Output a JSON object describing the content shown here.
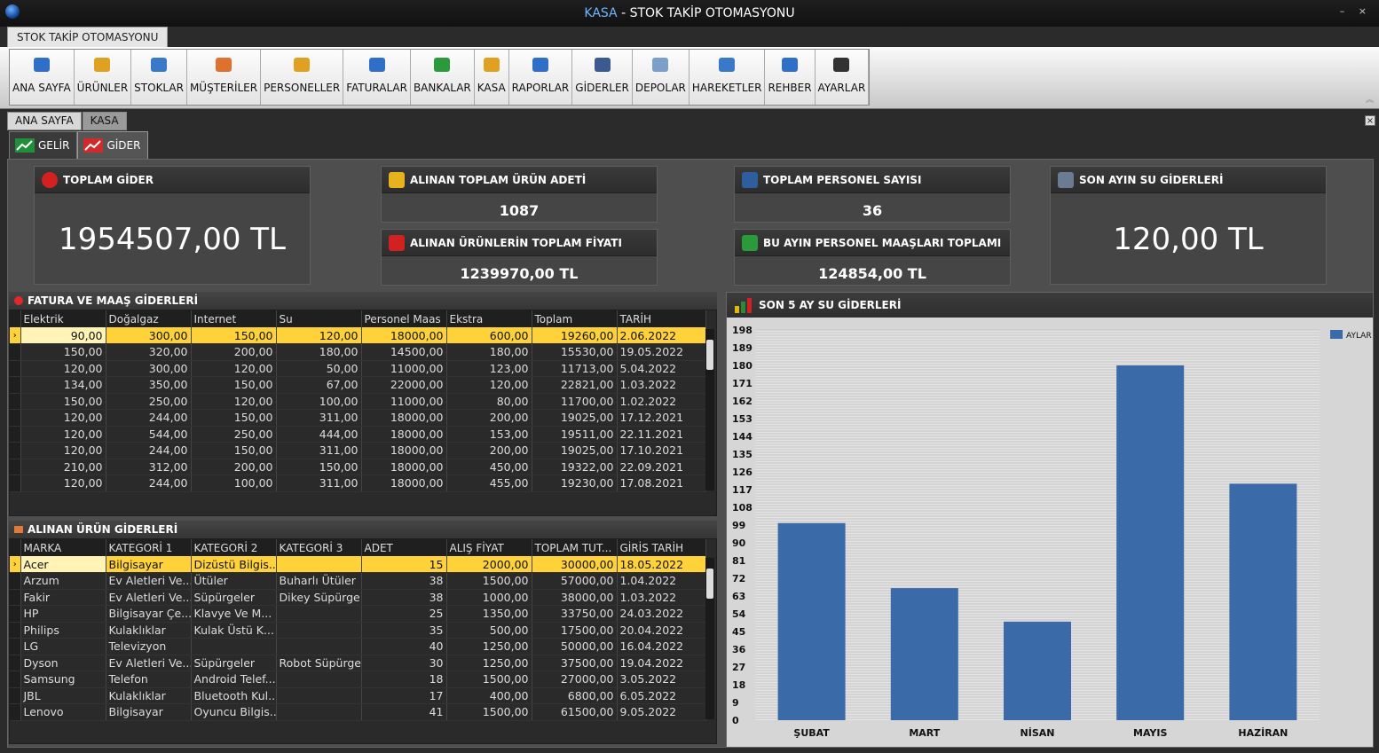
{
  "window": {
    "title_prefix": "KASA",
    "title_rest": " - STOK TAKİP OTOMASYONU",
    "controls": "– ×"
  },
  "app_tab": "STOK TAKİP OTOMASYONU",
  "ribbon": [
    {
      "label": "ANA SAYFA",
      "icon": "home-icon"
    },
    {
      "label": "ÜRÜNLER",
      "icon": "products-icon"
    },
    {
      "label": "STOKLAR",
      "icon": "stock-chart-icon"
    },
    {
      "label": "MÜŞTERİLER",
      "icon": "handshake-icon"
    },
    {
      "label": "PERSONELLER",
      "icon": "staff-icon"
    },
    {
      "label": "FATURALAR",
      "icon": "invoice-icon"
    },
    {
      "label": "BANKALAR",
      "icon": "bank-icon"
    },
    {
      "label": "KASA",
      "icon": "cash-icon"
    },
    {
      "label": "RAPORLAR",
      "icon": "clipboard-icon"
    },
    {
      "label": "GİDERLER",
      "icon": "expense-icon"
    },
    {
      "label": "DEPOLAR",
      "icon": "warehouse-icon"
    },
    {
      "label": "HAREKETLER",
      "icon": "activity-icon"
    },
    {
      "label": "REHBER",
      "icon": "phone-icon"
    },
    {
      "label": "AYARLAR",
      "icon": "gears-icon"
    }
  ],
  "doc_tabs": [
    "ANA SAYFA",
    "KASA"
  ],
  "sub_tabs": [
    "GELİR",
    "GİDER"
  ],
  "cards": {
    "total_expense": {
      "title": "TOPLAM GİDER",
      "value": "1954507,00 TL"
    },
    "product_count": {
      "title": "ALINAN TOPLAM ÜRÜN ADETİ",
      "value": "1087"
    },
    "product_price": {
      "title": "ALINAN ÜRÜNLERİN TOPLAM FİYATI",
      "value": "1239970,00 TL"
    },
    "staff_count": {
      "title": "TOPLAM PERSONEL SAYISI",
      "value": "36"
    },
    "staff_salary": {
      "title": "BU AYIN PERSONEL MAAŞLARI TOPLAMI",
      "value": "124854,00 TL"
    },
    "water": {
      "title": "SON AYIN SU GİDERLERİ",
      "value": "120,00 TL"
    }
  },
  "bills": {
    "title": "FATURA VE MAAŞ GİDERLERİ",
    "columns": [
      "Elektrik",
      "Doğalgaz",
      "Internet",
      "Su",
      "Personel Maas",
      "Ekstra",
      "Toplam",
      "TARİH"
    ],
    "rows": [
      [
        "90,00",
        "300,00",
        "150,00",
        "120,00",
        "18000,00",
        "600,00",
        "19260,00",
        "2.06.2022"
      ],
      [
        "150,00",
        "320,00",
        "200,00",
        "180,00",
        "14500,00",
        "180,00",
        "15530,00",
        "19.05.2022"
      ],
      [
        "120,00",
        "300,00",
        "120,00",
        "50,00",
        "11000,00",
        "123,00",
        "11713,00",
        "5.04.2022"
      ],
      [
        "134,00",
        "350,00",
        "150,00",
        "67,00",
        "22000,00",
        "120,00",
        "22821,00",
        "1.03.2022"
      ],
      [
        "150,00",
        "250,00",
        "120,00",
        "100,00",
        "11000,00",
        "80,00",
        "11700,00",
        "1.02.2022"
      ],
      [
        "120,00",
        "244,00",
        "150,00",
        "311,00",
        "18000,00",
        "200,00",
        "19025,00",
        "17.12.2021"
      ],
      [
        "120,00",
        "544,00",
        "250,00",
        "444,00",
        "18000,00",
        "153,00",
        "19511,00",
        "22.11.2021"
      ],
      [
        "120,00",
        "244,00",
        "150,00",
        "311,00",
        "18000,00",
        "200,00",
        "19025,00",
        "17.10.2021"
      ],
      [
        "210,00",
        "312,00",
        "200,00",
        "150,00",
        "18000,00",
        "450,00",
        "19322,00",
        "22.09.2021"
      ],
      [
        "120,00",
        "244,00",
        "100,00",
        "311,00",
        "18000,00",
        "455,00",
        "19230,00",
        "17.08.2021"
      ]
    ]
  },
  "products": {
    "title": "ALINAN ÜRÜN GİDERLERİ",
    "columns": [
      "MARKA",
      "KATEGORİ 1",
      "KATEGORİ 2",
      "KATEGORİ 3",
      "ADET",
      "ALIŞ FİYAT",
      "TOPLAM TUT...",
      "GİRİS TARİH"
    ],
    "rows": [
      [
        "Acer",
        "Bilgisayar",
        "Dizüstü Bilgis...",
        "",
        "15",
        "2000,00",
        "30000,00",
        "18.05.2022"
      ],
      [
        "Arzum",
        "Ev Aletleri Ve...",
        "Ütüler",
        "Buharlı Ütüler",
        "38",
        "1500,00",
        "57000,00",
        "1.04.2022"
      ],
      [
        "Fakir",
        "Ev Aletleri Ve...",
        "Süpürgeler",
        "Dikey Süpürge",
        "38",
        "1000,00",
        "38000,00",
        "1.03.2022"
      ],
      [
        "HP",
        "Bilgisayar Çe...",
        "Klavye Ve M...",
        "",
        "25",
        "1350,00",
        "33750,00",
        "24.03.2022"
      ],
      [
        "Philips",
        "Kulaklıklar",
        "Kulak Üstü K...",
        "",
        "35",
        "500,00",
        "17500,00",
        "20.04.2022"
      ],
      [
        "LG",
        "Televizyon",
        "",
        "",
        "40",
        "1250,00",
        "50000,00",
        "16.04.2022"
      ],
      [
        "Dyson",
        "Ev Aletleri Ve...",
        "Süpürgeler",
        "Robot Süpürge",
        "30",
        "1250,00",
        "37500,00",
        "19.04.2022"
      ],
      [
        "Samsung",
        "Telefon",
        "Android Telef...",
        "",
        "18",
        "1500,00",
        "27000,00",
        "3.05.2022"
      ],
      [
        "JBL",
        "Kulaklıklar",
        "Bluetooth Kul...",
        "",
        "17",
        "400,00",
        "6800,00",
        "6.05.2022"
      ],
      [
        "Lenovo",
        "Bilgisayar",
        "Oyuncu Bilgis...",
        "",
        "41",
        "1500,00",
        "61500,00",
        "9.05.2022"
      ]
    ]
  },
  "chart_data": {
    "type": "bar",
    "title": "SON 5 AY SU GİDERLERİ",
    "categories": [
      "ŞUBAT",
      "MART",
      "NİSAN",
      "MAYIS",
      "HAZİRAN"
    ],
    "series": [
      {
        "name": "AYLAR",
        "values": [
          100,
          67,
          50,
          180,
          120
        ],
        "color": "#3a6aa8"
      }
    ],
    "yticks": [
      0,
      9,
      18,
      27,
      36,
      45,
      54,
      63,
      72,
      81,
      90,
      99,
      108,
      117,
      126,
      135,
      144,
      153,
      162,
      171,
      180,
      189,
      198
    ],
    "ylim": [
      0,
      198
    ],
    "legend": "top-right",
    "grid": true
  }
}
